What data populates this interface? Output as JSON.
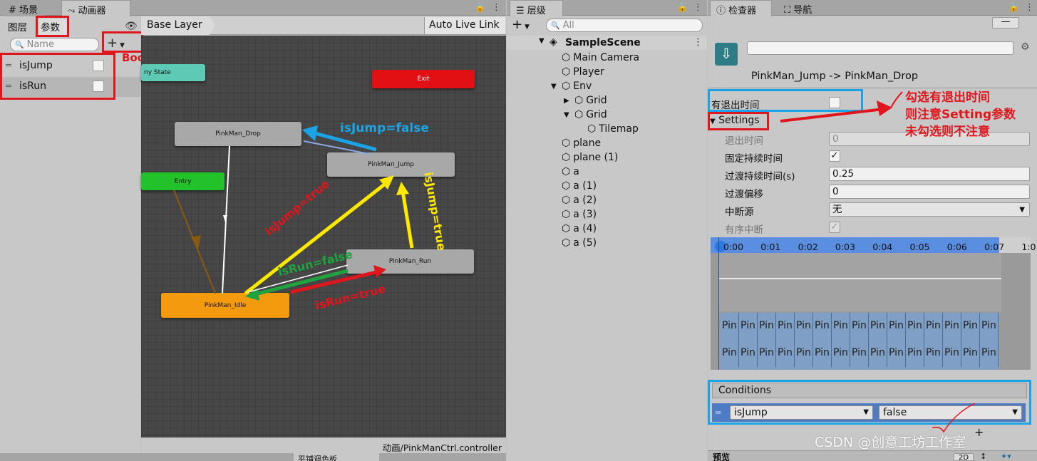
{
  "colors": {
    "accent_red": "#e0161d",
    "accent_blue": "#1aa3e6",
    "node_gray": "#a8a8a8",
    "node_orange": "#f39a0f",
    "node_green": "#22c22a",
    "node_red": "#e01014",
    "node_teal": "#5ec9b4"
  },
  "animator": {
    "tabs": [
      {
        "label": "场景",
        "icon": "grid-icon"
      },
      {
        "label": "动画器",
        "icon": "animator-icon"
      }
    ],
    "left_tabs": [
      "图层",
      "参数"
    ],
    "search_placeholder": "Name",
    "add_label": "+",
    "params": [
      {
        "name": "isJump",
        "checked": false
      },
      {
        "name": "isRun",
        "checked": false
      }
    ],
    "breadcrumb": "Base Layer",
    "auto_live_link": "Auto Live Link",
    "footer_path": "动画/PinkManCtrl.controller",
    "nodes": {
      "any_state": "ny State",
      "exit": "Exit",
      "drop": "PinkMan_Drop",
      "jump": "PinkMan_Jump",
      "entry": "Entry",
      "run": "PinkMan_Run",
      "idle": "PinkMan_Idle"
    }
  },
  "annotations": {
    "bool": "Bool",
    "jump_false": "isJump=false",
    "jump_true_left": "isJump=true",
    "jump_true_right": "isJump=true",
    "run_false": "isRun=false",
    "run_true": "isRun=true",
    "note_line1": "勾选有退出时间",
    "note_line2": "则注意Setting参数",
    "note_line3": "未勾选则不注意",
    "watermark": "CSDN @创意工坊工作室"
  },
  "hierarchy": {
    "tab": "层级",
    "search_placeholder": "All",
    "scene": "SampleScene",
    "items": [
      "Main Camera",
      "Player",
      "Env",
      "Grid",
      "Grid",
      "Tilemap",
      "plane",
      "plane (1)",
      "a",
      "a (1)",
      "a (2)",
      "a (3)",
      "a (4)",
      "a (5)"
    ],
    "bottom_tab": "平铺调色板"
  },
  "inspector": {
    "tabs": [
      "检查器",
      "导航"
    ],
    "transition_title": "PinkMan_Jump -> PinkMan_Drop",
    "has_exit_time_label": "有退出时间",
    "settings_label": "Settings",
    "rows": [
      {
        "label": "退出时间",
        "value": "0"
      },
      {
        "label": "固定持续时间",
        "value": "✓"
      },
      {
        "label": "过渡持续时间(s)",
        "value": "0.25"
      },
      {
        "label": "过渡偏移",
        "value": "0"
      },
      {
        "label": "中断源",
        "value": "无"
      },
      {
        "label": "有序中断",
        "value": "✓"
      }
    ],
    "timeline_ticks": [
      "0:00",
      "0:01",
      "0:02",
      "0:03",
      "0:04",
      "0:05",
      "0:06",
      "0:07",
      "1:0"
    ],
    "clip_label": "Pin",
    "conditions_label": "Conditions",
    "condition": {
      "param": "isJump",
      "value": "false"
    },
    "preview_label": "预览",
    "preview_btn": "2D"
  }
}
